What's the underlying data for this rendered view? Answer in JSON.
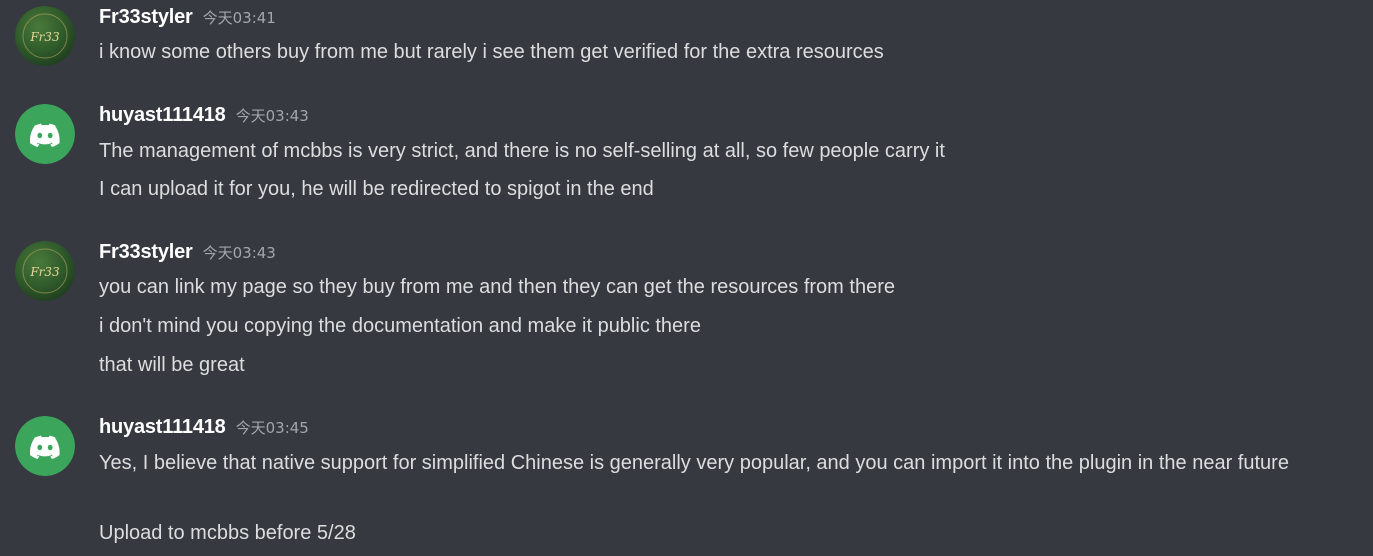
{
  "messages": [
    {
      "username": "Fr33styler",
      "timestamp": "今天03:41",
      "lines": [
        "i know some others buy from me but rarely i see them get verified for the extra resources"
      ]
    },
    {
      "username": "huyast111418",
      "timestamp": "今天03:43",
      "lines": [
        "The management of mcbbs is very strict, and there is no self-selling at all, so few people carry it",
        "I can upload it for you, he will be redirected to spigot in the end"
      ]
    },
    {
      "username": "Fr33styler",
      "timestamp": "今天03:43",
      "lines": [
        "you can link my page so they buy from me and then they can get the resources from there",
        "i don't mind you copying the documentation and make it public there",
        "that will be great"
      ]
    },
    {
      "username": "huyast111418",
      "timestamp": "今天03:45",
      "lines": [
        "Yes, I believe that native support for simplified Chinese is generally very popular, and you can import it into the plugin in the near future",
        "Upload to mcbbs before 5/28"
      ]
    }
  ],
  "colors": {
    "background": "#36393f",
    "discord_green": "#3ba55c",
    "text": "#dcddde",
    "username": "#ffffff",
    "timestamp": "#a3a6aa"
  },
  "icons": {
    "fr33styler_avatar": "fr33styler-logo-avatar",
    "huyast_avatar": "discord-default-avatar-icon"
  }
}
